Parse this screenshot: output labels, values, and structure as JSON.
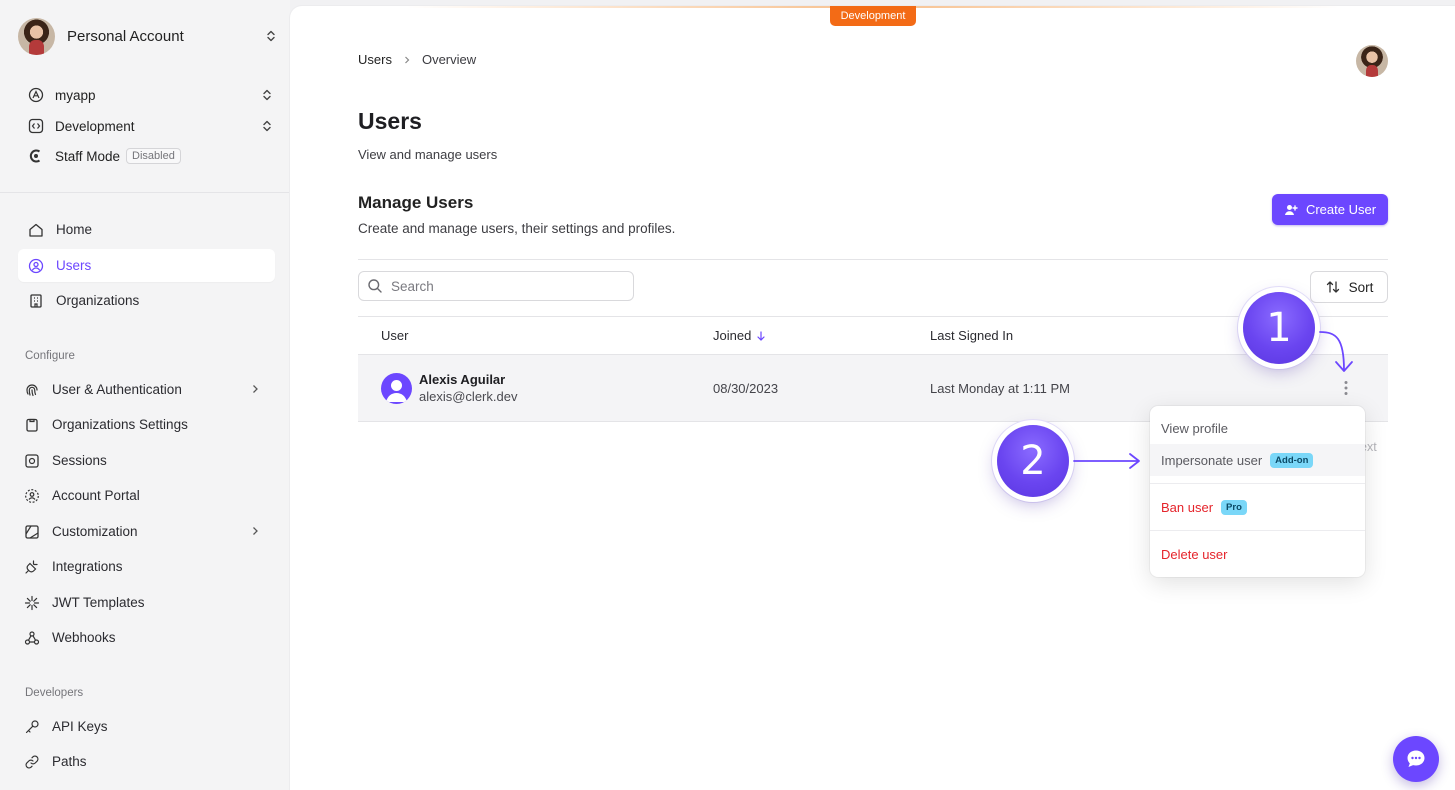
{
  "sidebar": {
    "account_name": "Personal Account",
    "app_name": "myapp",
    "env_name": "Development",
    "staff_mode_label": "Staff Mode",
    "staff_mode_badge": "Disabled",
    "nav": {
      "home": "Home",
      "users": "Users",
      "organizations": "Organizations"
    },
    "configure_label": "Configure",
    "configure": {
      "user_auth": "User & Authentication",
      "org_settings": "Organizations Settings",
      "sessions": "Sessions",
      "account_portal": "Account Portal",
      "customization": "Customization",
      "integrations": "Integrations",
      "jwt_templates": "JWT Templates",
      "webhooks": "Webhooks"
    },
    "developers_label": "Developers",
    "developers": {
      "api_keys": "API Keys",
      "paths": "Paths"
    }
  },
  "header": {
    "env_tag": "Development",
    "breadcrumb": [
      "Users",
      "Overview"
    ]
  },
  "page": {
    "title": "Users",
    "subtitle": "View and manage users",
    "section_title": "Manage Users",
    "section_subtitle": "Create and manage users, their settings and profiles.",
    "create_button": "Create User",
    "search_placeholder": "Search",
    "sort_button": "Sort"
  },
  "table": {
    "columns": {
      "user": "User",
      "joined": "Joined",
      "last_signed_in": "Last Signed In"
    },
    "rows": [
      {
        "name": "Alexis Aguilar",
        "email": "alexis@clerk.dev",
        "joined": "08/30/2023",
        "last_signed_in": "Last Monday at 1:11 PM"
      }
    ],
    "pagination_ghost": "ext"
  },
  "menu": {
    "view_profile": "View profile",
    "impersonate": "Impersonate user",
    "impersonate_badge": "Add-on",
    "ban": "Ban user",
    "ban_badge": "Pro",
    "delete": "Delete user"
  },
  "callouts": {
    "step1": "1",
    "step2": "2"
  },
  "colors": {
    "accent": "#6c47ff",
    "env_tag": "#f36b16",
    "danger": "#e5242b",
    "badge": "#7ad7f8"
  }
}
